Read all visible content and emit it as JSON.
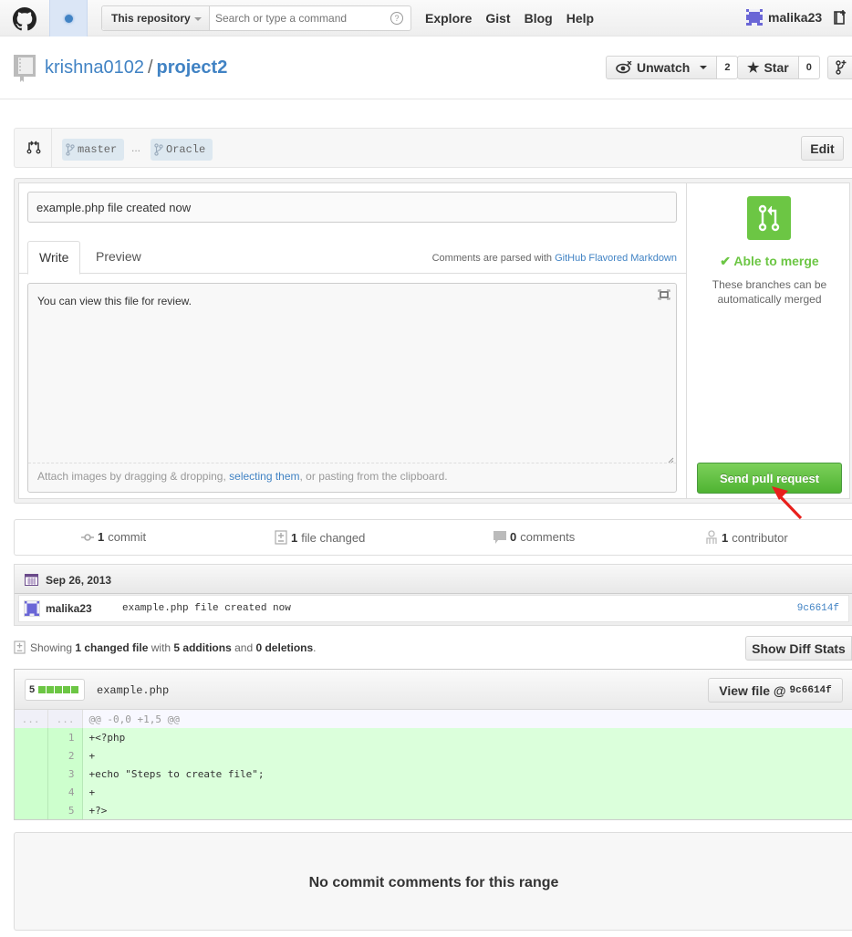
{
  "header": {
    "search_scope": "This repository",
    "search_placeholder": "Search or type a command",
    "search_help": "?",
    "nav": [
      "Explore",
      "Gist",
      "Blog",
      "Help"
    ],
    "username": "malika23"
  },
  "repo": {
    "owner": "krishna0102",
    "separator": "/",
    "name": "project2",
    "watch_label": "Unwatch",
    "watch_count": "2",
    "star_label": "Star",
    "star_count": "0"
  },
  "range": {
    "base": "master",
    "dots": "...",
    "head": "Oracle",
    "edit_label": "Edit"
  },
  "compose": {
    "title_value": "example.php file created now",
    "tabs": [
      "Write",
      "Preview"
    ],
    "md_note_prefix": "Comments are parsed with ",
    "md_note_link": "GitHub Flavored Markdown",
    "body_value": "You can view this file for review.",
    "attach_prefix": "Attach images by dragging & dropping, ",
    "attach_link": "selecting them",
    "attach_suffix": ", or pasting from the clipboard."
  },
  "merge": {
    "status": "✔ Able to merge",
    "description": "These branches can be automatically merged",
    "send_label": "Send pull request",
    "color": "#6cc644"
  },
  "stats": [
    {
      "count": "1",
      "label": "commit"
    },
    {
      "count": "1",
      "label": "file changed"
    },
    {
      "count": "0",
      "label": "comments"
    },
    {
      "count": "1",
      "label": "contributor"
    }
  ],
  "commits": {
    "date": "Sep 26, 2013",
    "items": [
      {
        "author": "malika23",
        "message": "example.php file created now",
        "sha": "9c6614f"
      }
    ]
  },
  "summary": {
    "prefix": "Showing ",
    "files": "1 changed file",
    "mid1": " with ",
    "additions": "5 additions",
    "mid2": " and ",
    "deletions": "0 deletions",
    "suffix": ".",
    "diff_stats_label": "Show Diff Stats"
  },
  "file": {
    "additions": "5",
    "name": "example.php",
    "view_label": "View file @",
    "view_sha": "9c6614f",
    "hunk": {
      "old": "...",
      "new": "...",
      "text": "@@ -0,0 +1,5 @@"
    },
    "lines": [
      {
        "new": "1",
        "code": "+<?php"
      },
      {
        "new": "2",
        "code": "+"
      },
      {
        "new": "3",
        "code": "+echo \"Steps to create file\";"
      },
      {
        "new": "4",
        "code": "+"
      },
      {
        "new": "5",
        "code": "+?>"
      }
    ]
  },
  "comments_empty": "No commit comments for this range"
}
